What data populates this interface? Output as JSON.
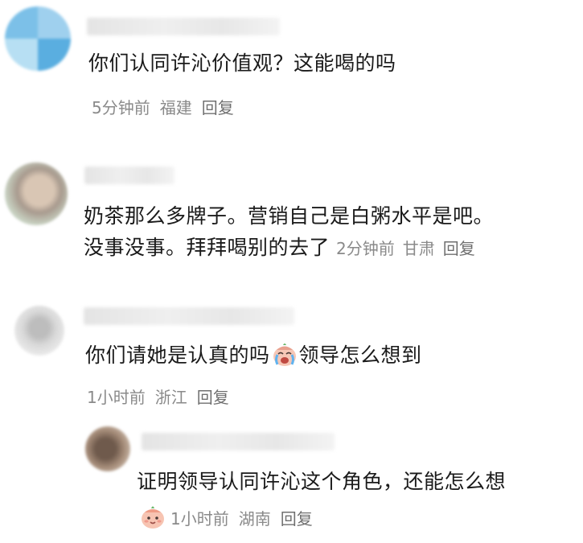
{
  "comments": [
    {
      "text": "你们认同许沁价值观？这能喝的吗",
      "time": "5分钟前",
      "location": "福建",
      "reply": "回复"
    },
    {
      "text_line1": "奶茶那么多牌子。营销自己是白粥水平是吧。",
      "text_line2": "没事没事。拜拜喝别的去了",
      "time": "2分钟前",
      "location": "甘肃",
      "reply": "回复"
    },
    {
      "text_before": "你们请她是认真的吗",
      "text_after": "领导怎么想到",
      "time": "1小时前",
      "location": "浙江",
      "reply": "回复"
    }
  ],
  "reply_comment": {
    "text": "证明领导认同许沁这个角色，还能怎么想",
    "time": "1小时前",
    "location": "湖南",
    "reply": "回复"
  },
  "icons": {
    "crying_emoji": "crying-face-emoji",
    "peach_emoji": "peach-face-emoji"
  },
  "colors": {
    "text": "#1a1a1a",
    "meta": "#8a8a8a"
  }
}
